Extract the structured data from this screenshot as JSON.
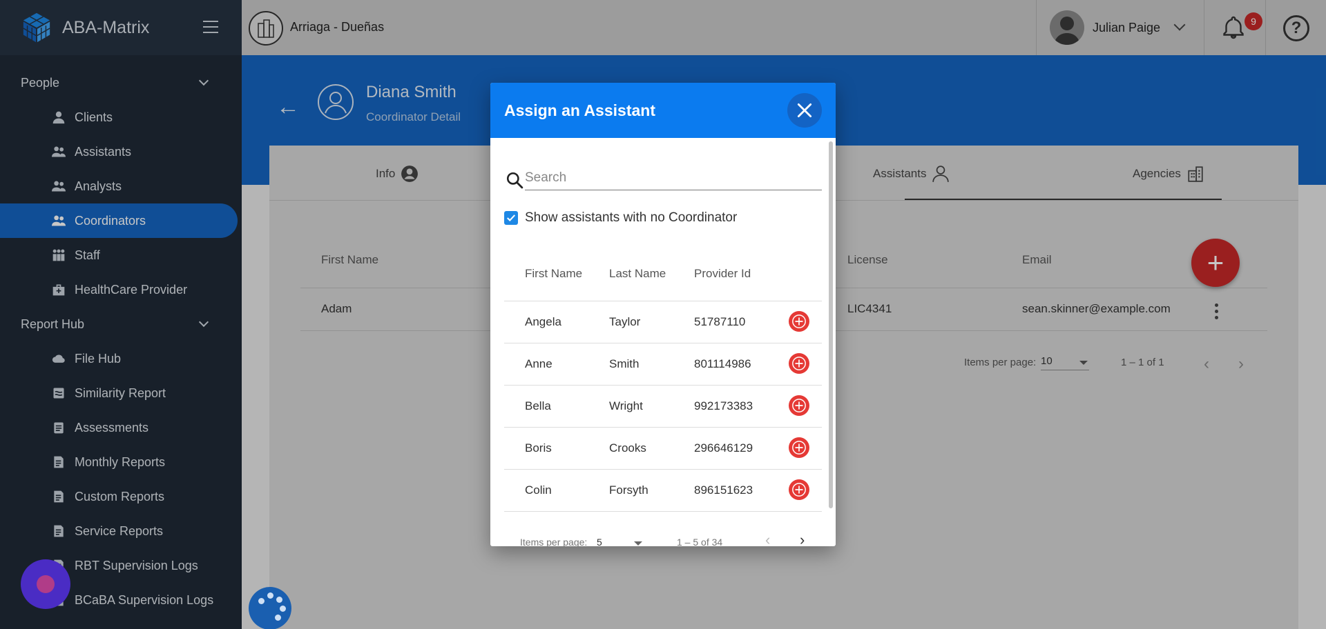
{
  "app": {
    "title": "ABA-Matrix"
  },
  "sidebar": {
    "sections": [
      {
        "label": "People"
      },
      {
        "label": "Report Hub"
      }
    ],
    "items": [
      {
        "label": "Clients",
        "icon": "person-icon"
      },
      {
        "label": "Assistants",
        "icon": "group-icon"
      },
      {
        "label": "Analysts",
        "icon": "group-icon"
      },
      {
        "label": "Coordinators",
        "icon": "group-icon",
        "active": true
      },
      {
        "label": "Staff",
        "icon": "staff-icon"
      },
      {
        "label": "HealthCare Provider",
        "icon": "medical-kit-icon"
      },
      {
        "label": "File Hub",
        "icon": "cloud-icon"
      },
      {
        "label": "Similarity Report",
        "icon": "report-icon"
      },
      {
        "label": "Assessments",
        "icon": "clipboard-icon"
      },
      {
        "label": "Monthly Reports",
        "icon": "report-icon"
      },
      {
        "label": "Custom Reports",
        "icon": "report-icon"
      },
      {
        "label": "Service Reports",
        "icon": "report-icon"
      },
      {
        "label": "RBT Supervision Logs",
        "icon": "report-icon"
      },
      {
        "label": "BCaBA Supervision Logs",
        "icon": "report-icon"
      }
    ]
  },
  "topbar": {
    "org_name": "Arriaga - Dueñas",
    "user_name": "Julian Paige",
    "notification_count": "9",
    "help_glyph": "?"
  },
  "coordinator": {
    "name": "Diana Smith",
    "subtitle": "Coordinator Detail"
  },
  "tabs": [
    {
      "label": "Info"
    },
    {
      "label": "Assistants"
    },
    {
      "label": "Agencies"
    }
  ],
  "table": {
    "headers": {
      "first_name": "First Name",
      "license": "License",
      "email": "Email"
    },
    "row": {
      "first_name": "Adam",
      "license": "LIC4341",
      "email": "sean.skinner@example.com"
    },
    "pager": {
      "label": "Items per page:",
      "value": "10",
      "range": "1 – 1 of 1"
    }
  },
  "dialog": {
    "title": "Assign an Assistant",
    "search_placeholder": "Search",
    "checkbox_label": "Show assistants with no Coordinator",
    "headers": {
      "first": "First Name",
      "last": "Last Name",
      "provider": "Provider Id"
    },
    "rows": [
      {
        "first": "Angela",
        "last": "Taylor",
        "provider": "51787110"
      },
      {
        "first": "Anne",
        "last": "Smith",
        "provider": "801114986"
      },
      {
        "first": "Bella",
        "last": "Wright",
        "provider": "992173383"
      },
      {
        "first": "Boris",
        "last": "Crooks",
        "provider": "296646129"
      },
      {
        "first": "Colin",
        "last": "Forsyth",
        "provider": "896151623"
      }
    ],
    "pager": {
      "label": "Items per page:",
      "value": "5",
      "range": "1 – 5 of 34"
    }
  },
  "colors": {
    "primary": "#1565c0",
    "dialog_header": "#0b7bef",
    "accent_red": "#e53935",
    "sidebar_bg": "#1f2a37"
  }
}
